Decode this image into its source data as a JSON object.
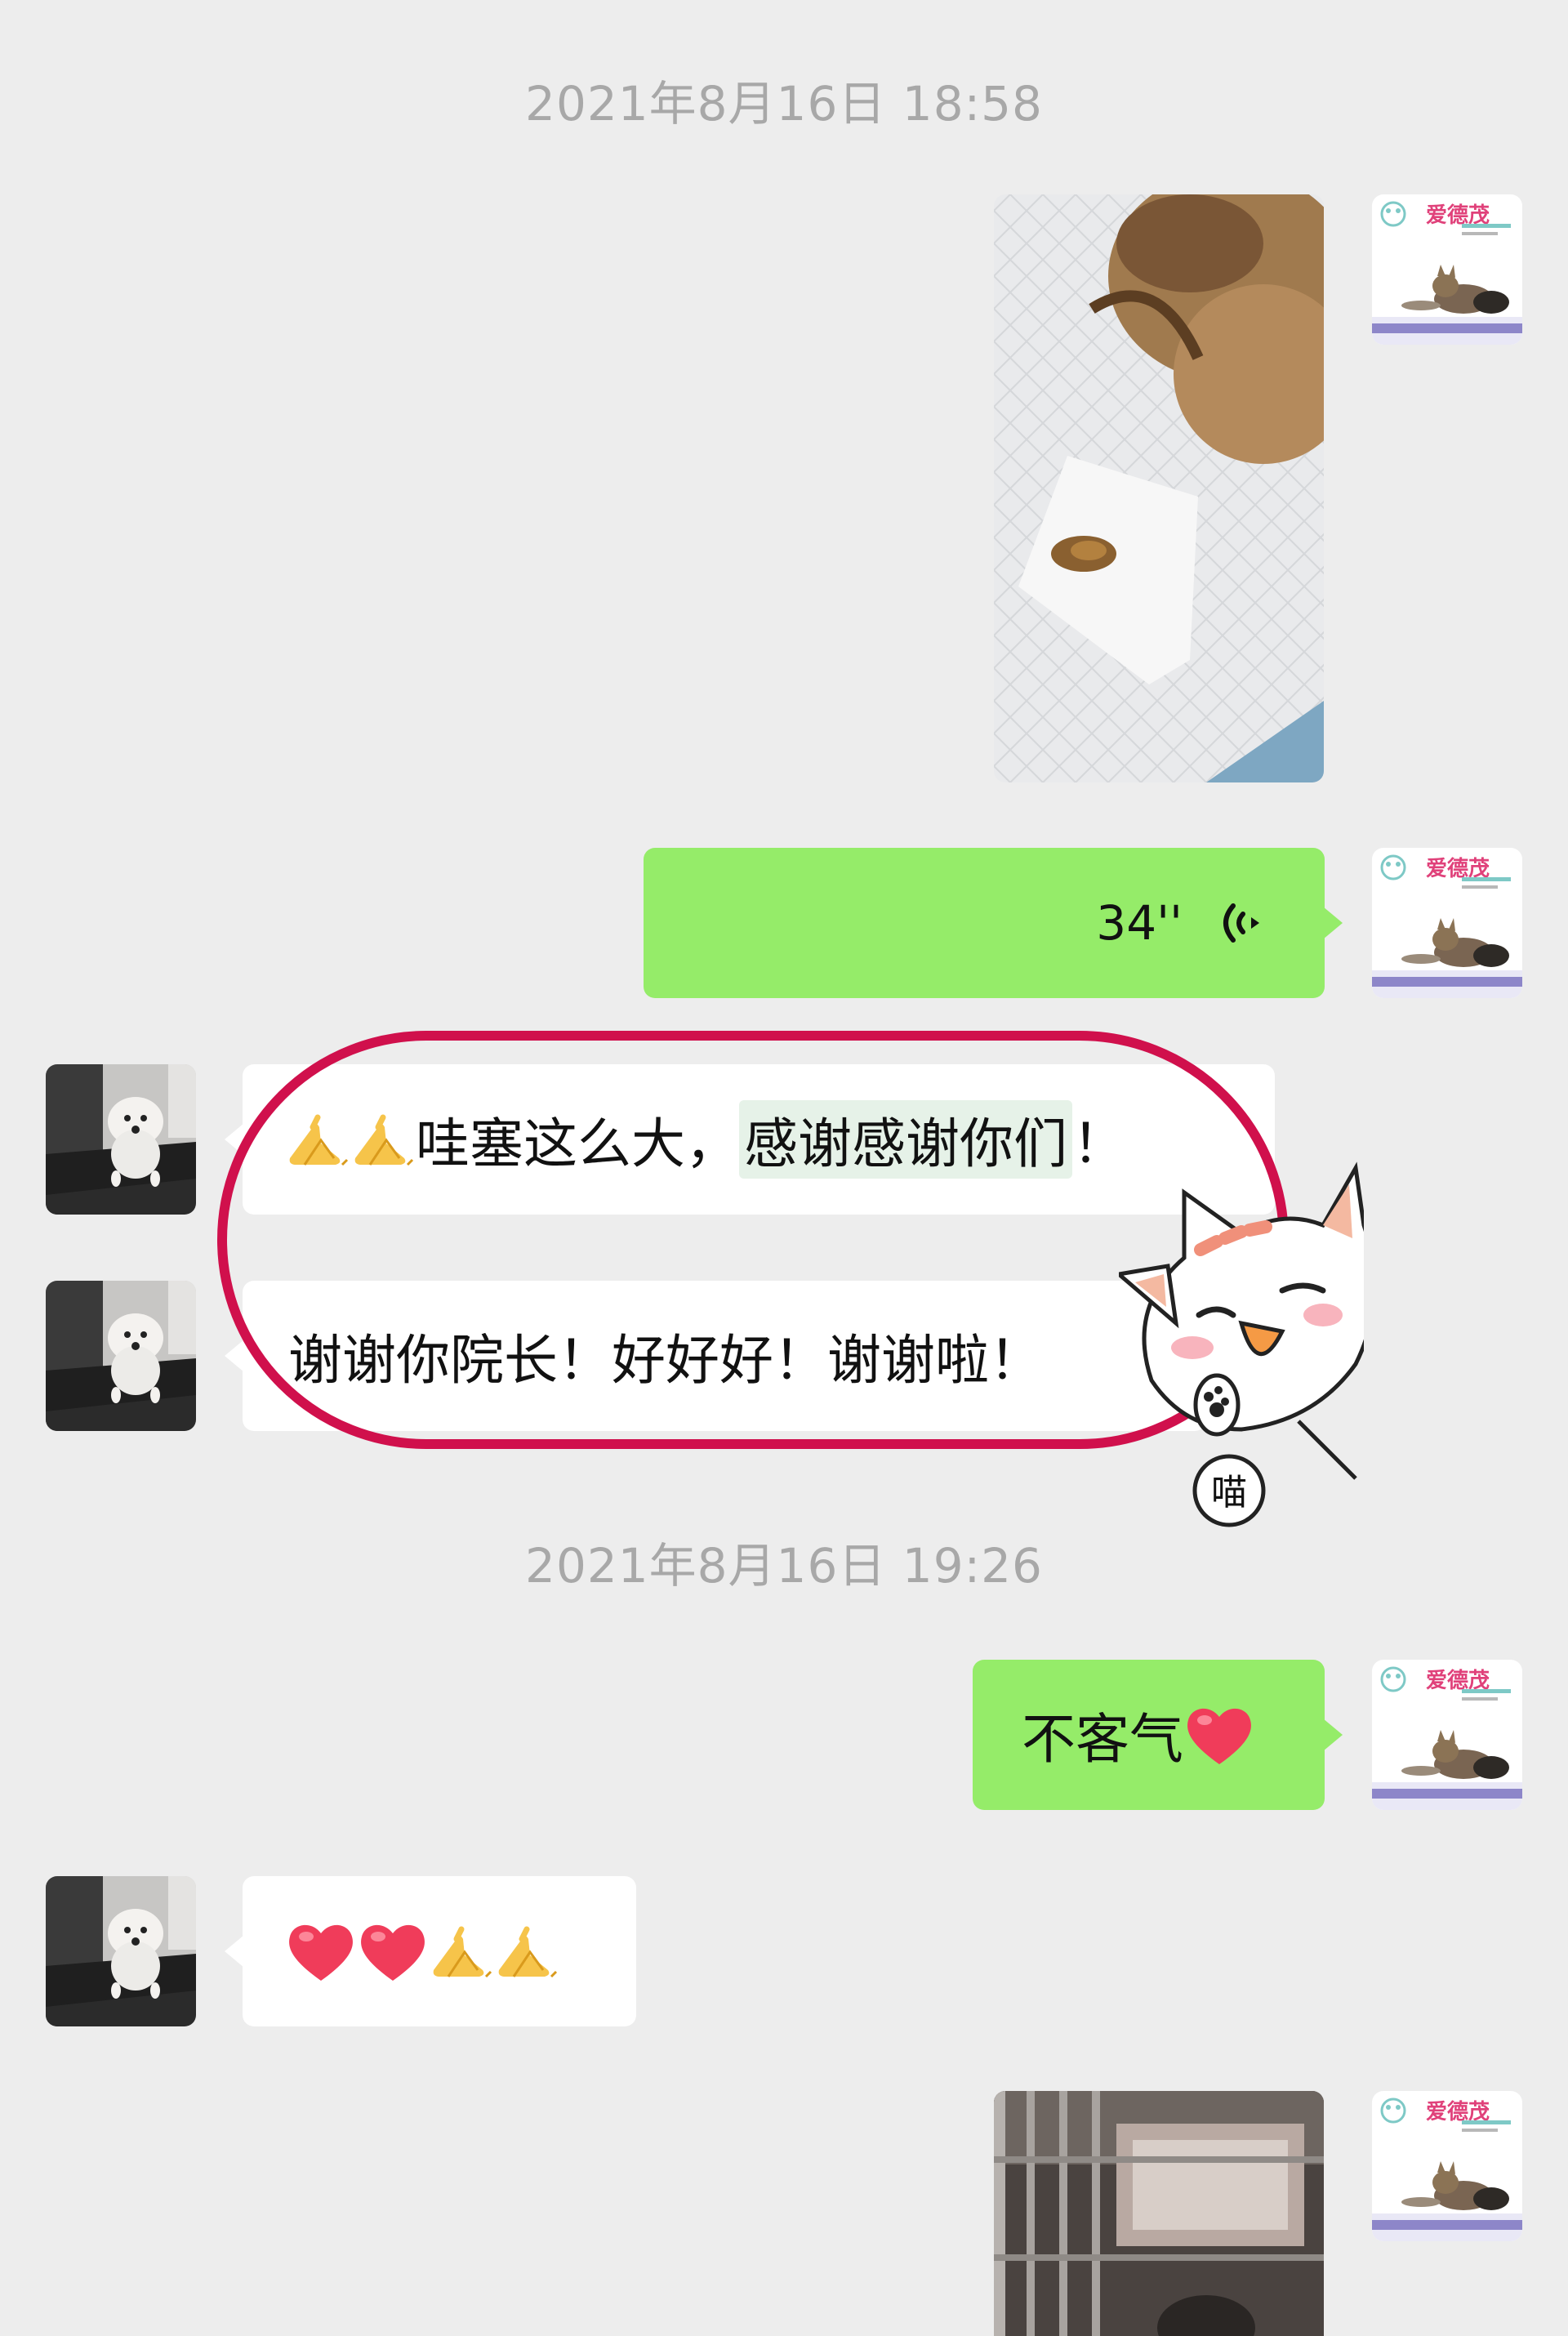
{
  "chat": {
    "timestamp1": "2021年8月16日 18:58",
    "timestamp2": "2021年8月16日 19:26",
    "voice": {
      "duration": "34''"
    },
    "msg_thanks": {
      "prefix": "哇塞这么大，",
      "highlight": "感谢感谢你们",
      "suffix": "！"
    },
    "msg_thanks2": "谢谢你院长！好好好！谢谢啦！",
    "reply": "不客气",
    "sticker_text": "喵",
    "logo_text": "爱德茂"
  },
  "colors": {
    "background": "#ededed",
    "sent_bubble": "#95ec69",
    "received_bubble": "#ffffff",
    "annotation_ring": "#d0104c",
    "timestamp": "#a8a8a8"
  },
  "icons": {
    "voice": "voice-wave-icon",
    "pray": "pray-emoji-icon",
    "heart": "heart-emoji-icon"
  }
}
